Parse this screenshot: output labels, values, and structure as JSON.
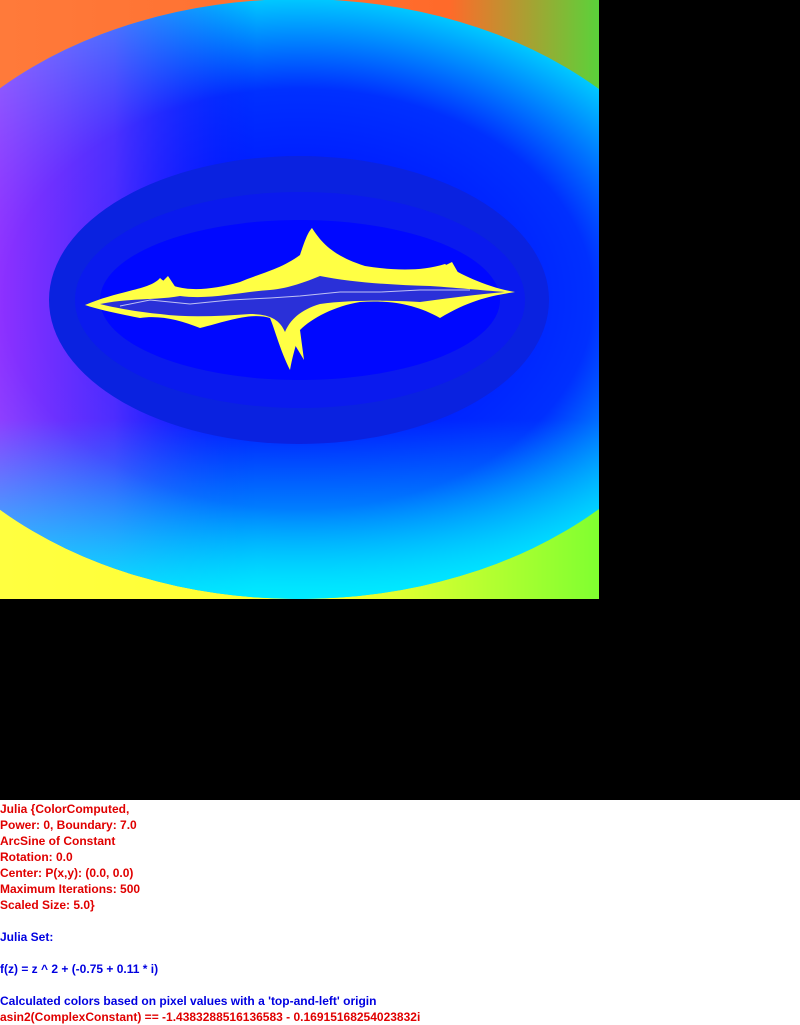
{
  "colors": {
    "params_text": "#e00000",
    "formula_text": "#0000e0",
    "canvas_background": "#000000",
    "fractal_fill": "#ffff44",
    "fractal_background": "#0000ff"
  },
  "fractal": {
    "name": "julia-set-render"
  },
  "params": {
    "line1": "Julia {ColorComputed,",
    "line2": "Power: 0, Boundary: 7.0",
    "line3": "ArcSine of Constant",
    "line4": "Rotation: 0.0",
    "line5": "Center: P(x,y): (0.0, 0.0)",
    "line6": "Maximum Iterations: 500",
    "line7": "Scaled Size: 5.0}"
  },
  "formula": {
    "title": "Julia Set:",
    "function": "f(z) = z ^ 2 + (-0.75 + 0.11 * i)",
    "note": "Calculated colors based on pixel values with a 'top-and-left' origin",
    "result": "asin2(ComplexConstant) == -1.4383288516136583 - 0.16915168254023832i"
  }
}
